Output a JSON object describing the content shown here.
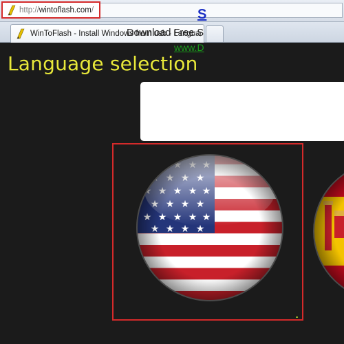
{
  "browser": {
    "address": {
      "prefix": "http://",
      "host": "wintoflash.com",
      "suffix": "/"
    },
    "tabs": [
      {
        "title": "WinToFlash - Install Windows from usb - Languag..."
      }
    ]
  },
  "page": {
    "title": "Language selection",
    "ad": {
      "headline": "S",
      "description": "Download Free S",
      "url": "www.D"
    },
    "languages": [
      {
        "icon": "us-flag-icon"
      },
      {
        "icon": "spain-flag-icon"
      }
    ]
  },
  "colors": {
    "page_background": "#1b1b1b",
    "title_color": "#e8e83a",
    "highlight_border": "#d42a2a",
    "ad_link": "#1b2fc4",
    "ad_url": "#1b9c1b"
  }
}
